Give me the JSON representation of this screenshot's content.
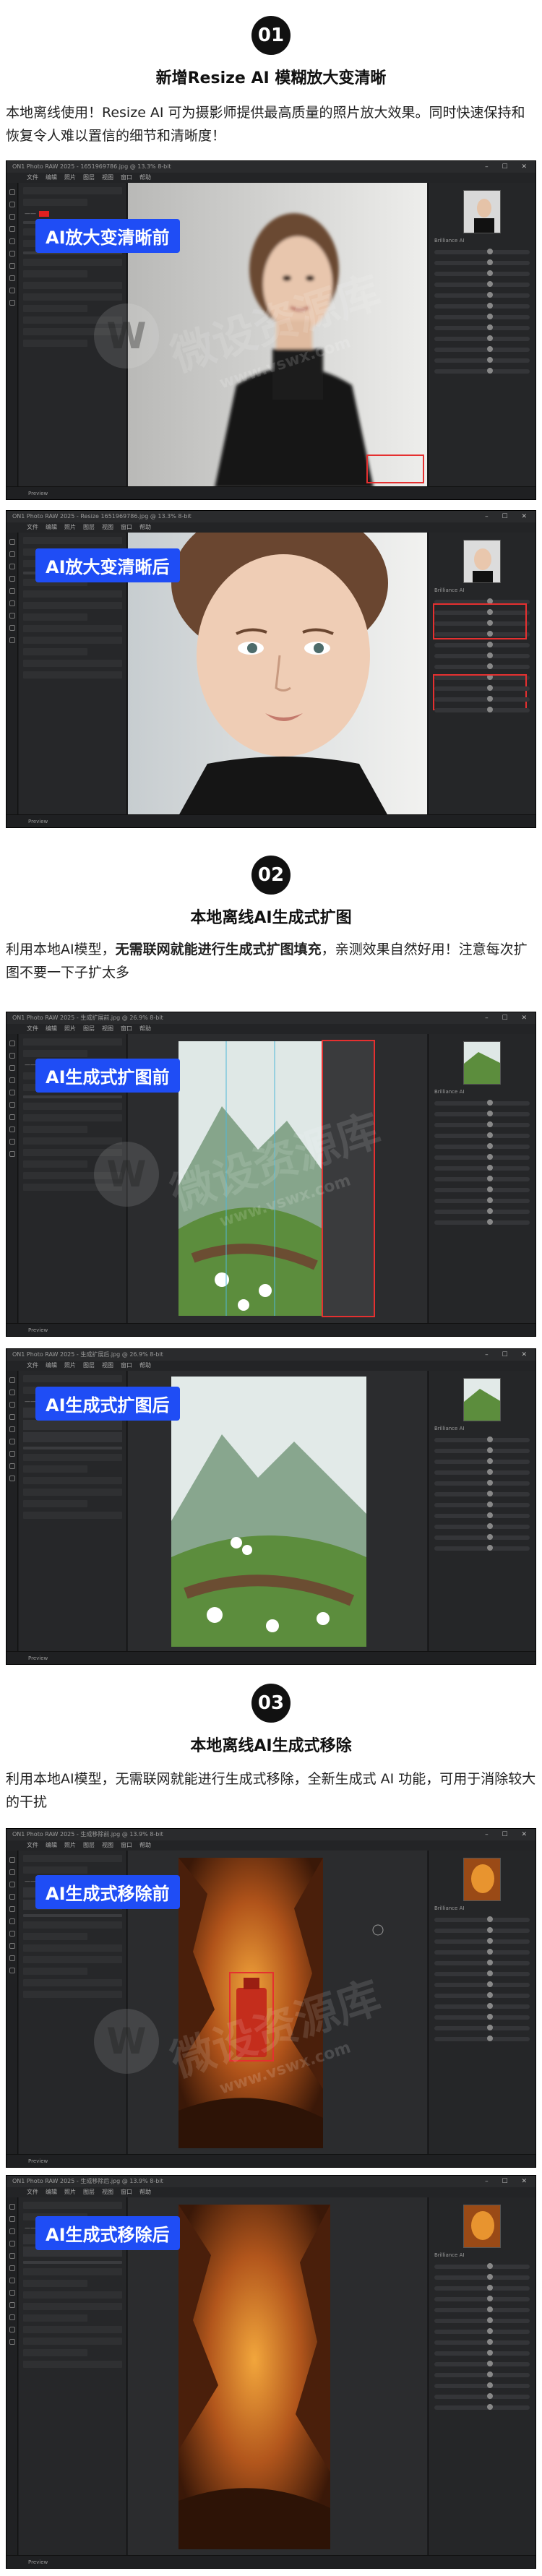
{
  "sections": [
    {
      "number": "01",
      "title": "新增Resize AI 模糊放大变清晰",
      "description": "本地离线使用！Resize AI 可为摄影师提供最高质量的照片放大效果。同时快速保持和恢复令人难以置信的细节和清晰度！",
      "before_label": "AI放大变清晰前",
      "after_label": "AI放大变清晰后"
    },
    {
      "number": "02",
      "title": "本地离线AI生成式扩图",
      "description_prefix": "利用本地AI模型，",
      "description_bold": "无需联网就能进行生成式扩图填充",
      "description_suffix": "，亲测效果自然好用！注意每次扩图不要一下子扩太多",
      "before_label": "AI生成式扩图前",
      "after_label": "AI生成式扩图后"
    },
    {
      "number": "03",
      "title": "本地离线AI生成式移除",
      "description": "利用本地AI模型，无需联网就能进行生成式移除，全新生成式 AI 功能，可用于消除较大的干扰",
      "before_label": "AI生成式移除前",
      "after_label": "AI生成式移除后"
    }
  ],
  "app": {
    "menu": [
      "文件",
      "编辑",
      "照片",
      "图层",
      "视图",
      "窗口",
      "帮助"
    ],
    "panel_title": "Brilliance AI",
    "status_text": "Preview",
    "titles": [
      "ON1 Photo RAW 2025 - 1651969786.jpg @ 13.3% 8-bit",
      "ON1 Photo RAW 2025 - Resize 1651969786.jpg @ 13.3% 8-bit",
      "ON1 Photo RAW 2025 - 生成扩展前.jpg @ 26.9% 8-bit",
      "ON1 Photo RAW 2025 - 生成扩展后.jpg @ 26.9% 8-bit",
      "ON1 Photo RAW 2025 - 生成移除前.jpg @ 13.9% 8-bit",
      "ON1 Photo RAW 2025 - 生成移除后.jpg @ 13.9% 8-bit"
    ]
  },
  "watermark": {
    "main": "微设资源库",
    "sub": "www.vswx.com",
    "logo": "W"
  },
  "colors": {
    "label_bg": "#1f4df5",
    "highlight": "#e53030"
  }
}
